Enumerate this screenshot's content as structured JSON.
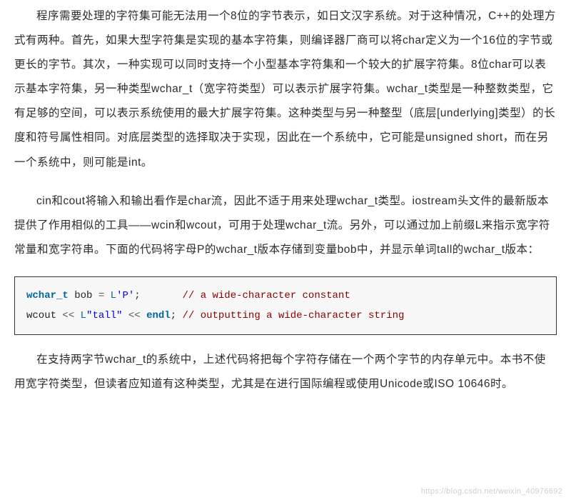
{
  "paragraphs": {
    "p1": "程序需要处理的字符集可能无法用一个8位的字节表示，如日文汉字系统。对于这种情况，C++的处理方式有两种。首先，如果大型字符集是实现的基本字符集，则编译器厂商可以将char定义为一个16位的字节或更长的字节。其次，一种实现可以同时支持一个小型基本字符集和一个较大的扩展字符集。8位char可以表示基本字符集，另一种类型wchar_t（宽字符类型）可以表示扩展字符集。wchar_t类型是一种整数类型，它有足够的空间，可以表示系统使用的最大扩展字符集。这种类型与另一种整型（底层[underlying]类型）的长度和符号属性相同。对底层类型的选择取决于实现，因此在一个系统中，它可能是unsigned short，而在另一个系统中，则可能是int。",
    "p2": "cin和cout将输入和输出看作是char流，因此不适于用来处理wchar_t类型。iostream头文件的最新版本提供了作用相似的工具——wcin和wcout，可用于处理wchar_t流。另外，可以通过加上前缀L来指示宽字符常量和宽字符串。下面的代码将字母P的wchar_t版本存储到变量bob中，并显示单词tall的wchar_t版本：",
    "p3": "在支持两字节wchar_t的系统中，上述代码将把每个字符存储在一个两个字节的内存单元中。本书不使用宽字符类型，但读者应知道有这种类型，尤其是在进行国际编程或使用Unicode或ISO 10646时。"
  },
  "code": {
    "line1": {
      "type": "wchar_t",
      "var": "bob",
      "assign": " = ",
      "prefix": "L",
      "lit": "'P'",
      "semi": ";       ",
      "comment": "// a wide-character constant"
    },
    "line2": {
      "stream": "wcout ",
      "op1": "<<",
      "space1": " ",
      "prefix": "L",
      "lit": "\"tall\"",
      "space2": " ",
      "op2": "<<",
      "space3": " ",
      "endl": "endl",
      "semi": "; ",
      "comment": "// outputting a wide-character string"
    }
  },
  "watermark": "https://blog.csdn.net/weixin_40976692"
}
